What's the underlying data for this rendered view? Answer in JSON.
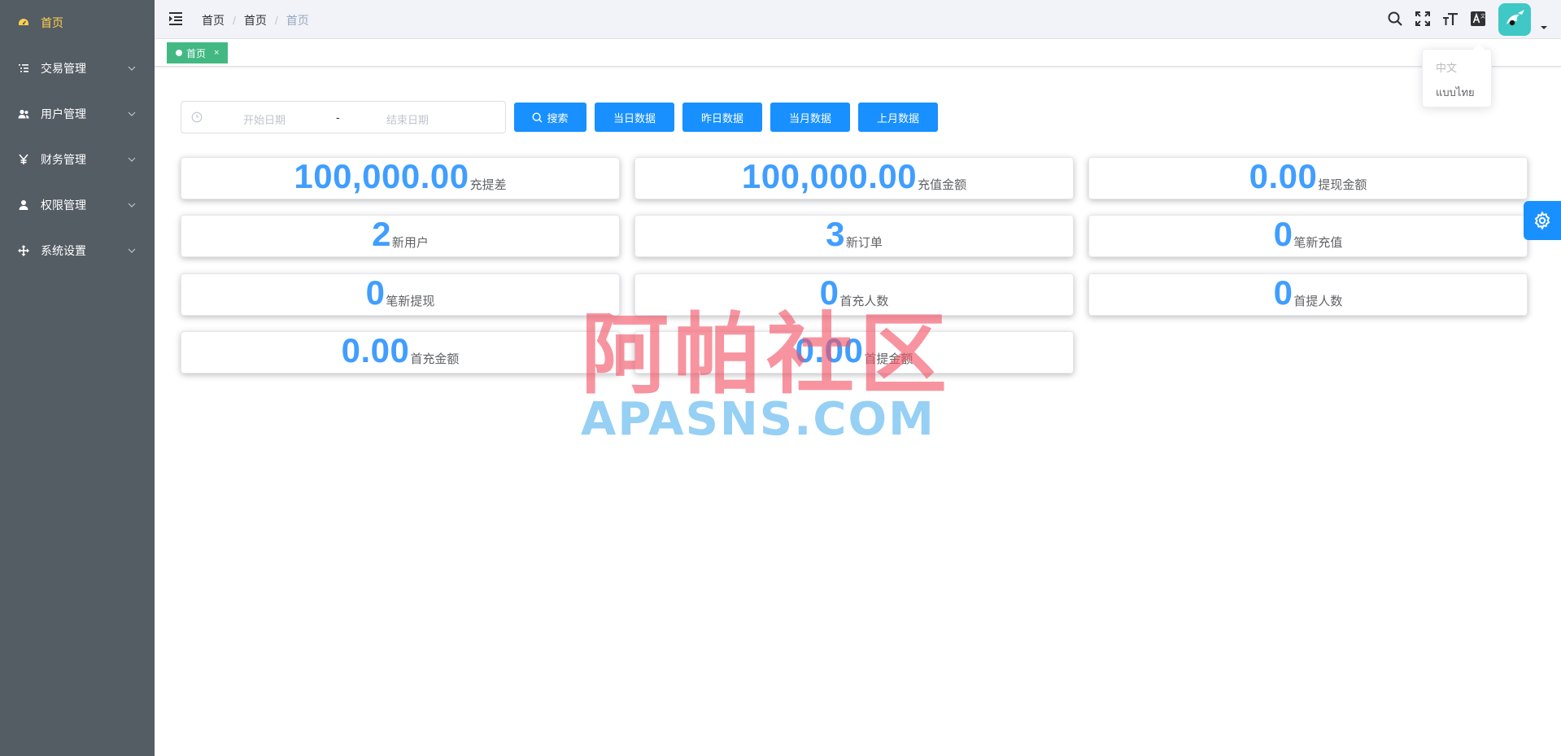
{
  "sidebar": {
    "items": [
      {
        "label": "首页",
        "icon": "dashboard-icon"
      },
      {
        "label": "交易管理",
        "icon": "list-icon"
      },
      {
        "label": "用户管理",
        "icon": "users-icon"
      },
      {
        "label": "财务管理",
        "icon": "yen-icon"
      },
      {
        "label": "权限管理",
        "icon": "user-icon"
      },
      {
        "label": "系统设置",
        "icon": "move-icon"
      }
    ],
    "active_color": "#ffd04b",
    "background": "#545c64"
  },
  "header": {
    "breadcrumb": [
      "首页",
      "首页",
      "首页"
    ]
  },
  "tags": {
    "items": [
      {
        "label": "首页",
        "close": "×"
      }
    ],
    "active_color": "#42b983"
  },
  "language_menu": {
    "items": [
      {
        "label": "中文",
        "disabled": true
      },
      {
        "label": "แบบไทย",
        "disabled": false
      }
    ]
  },
  "filter": {
    "start_placeholder": "开始日期",
    "separator": "-",
    "end_placeholder": "结束日期",
    "search_label": "搜索",
    "today_label": "当日数据",
    "yesterday_label": "昨日数据",
    "this_month_label": "当月数据",
    "last_month_label": "上月数据"
  },
  "stats": [
    {
      "value": "100,000.00",
      "label": "充提差"
    },
    {
      "value": "100,000.00",
      "label": "充值金额"
    },
    {
      "value": "0.00",
      "label": "提现金额"
    },
    {
      "value": "2",
      "label": "新用户"
    },
    {
      "value": "3",
      "label": "新订单"
    },
    {
      "value": "0",
      "label": "笔新充值"
    },
    {
      "value": "0",
      "label": "笔新提现"
    },
    {
      "value": "0",
      "label": "首充人数"
    },
    {
      "value": "0",
      "label": "首提人数"
    },
    {
      "value": "0.00",
      "label": "首充金额"
    },
    {
      "value": "0.00",
      "label": "首提金额"
    }
  ],
  "watermark": {
    "cn": "阿帕社区",
    "en": "APASNS.COM"
  },
  "colors": {
    "primary": "#1890ff",
    "stat_number": "#409eff"
  }
}
